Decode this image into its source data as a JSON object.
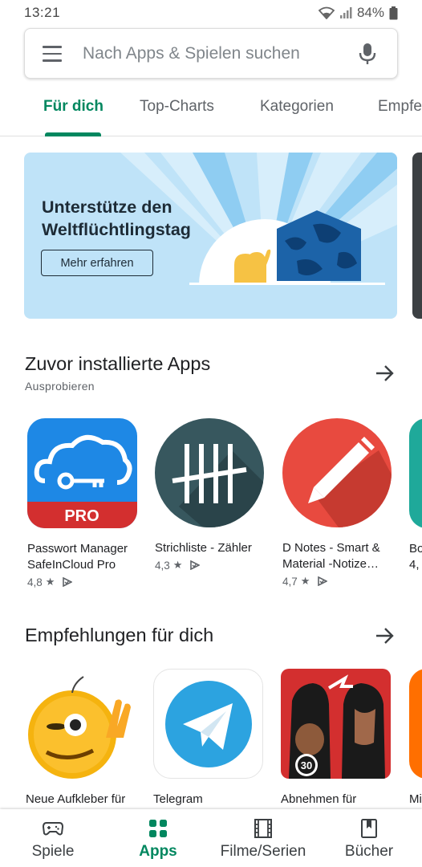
{
  "status_bar": {
    "time": "13:21",
    "battery": "84%"
  },
  "search": {
    "placeholder": "Nach Apps & Spielen suchen"
  },
  "tabs": [
    {
      "label": "Für dich",
      "active": true
    },
    {
      "label": "Top-Charts",
      "active": false
    },
    {
      "label": "Kategorien",
      "active": false
    },
    {
      "label": "Empfe",
      "active": false
    }
  ],
  "banner": {
    "title": "Unterstütze den Weltflüchtlingstag",
    "button_label": "Mehr erfahren"
  },
  "sections": [
    {
      "title": "Zuvor installierte Apps",
      "subtitle": "Ausprobieren",
      "apps": [
        {
          "name_line1": "Passwort Manager",
          "name_line2": "SafeInCloud Pro",
          "rating": "4,8",
          "icon": "cloud-key-icon"
        },
        {
          "name_line1": "Strichliste - Zähler",
          "name_line2": "",
          "rating": "4,3",
          "icon": "tally-marks-icon"
        },
        {
          "name_line1": "D Notes - Smart &",
          "name_line2": "Material -Notize…",
          "rating": "4,7",
          "icon": "pencil-icon"
        },
        {
          "name_line1": "Bo",
          "name_line2": "",
          "rating": "4,",
          "icon": "partial-app-icon"
        }
      ]
    },
    {
      "title": "Empfehlungen für dich",
      "apps": [
        {
          "name_line1": "Neue Aufkleber für",
          "icon": "emoji-sticker-icon"
        },
        {
          "name_line1": "Telegram",
          "icon": "paper-plane-icon"
        },
        {
          "name_line1": "Abnehmen für",
          "icon": "fitness-icon"
        },
        {
          "name_line1": "Mi",
          "icon": "partial-app-icon"
        }
      ]
    }
  ],
  "bottom_nav": [
    {
      "label": "Spiele",
      "icon": "gamepad-icon",
      "active": false
    },
    {
      "label": "Apps",
      "icon": "apps-grid-icon",
      "active": true
    },
    {
      "label": "Filme/Serien",
      "icon": "film-icon",
      "active": false
    },
    {
      "label": "Bücher",
      "icon": "bookmark-icon",
      "active": false
    }
  ],
  "colors": {
    "accent": "#01875f",
    "banner_bg": "#bfe3f8"
  }
}
